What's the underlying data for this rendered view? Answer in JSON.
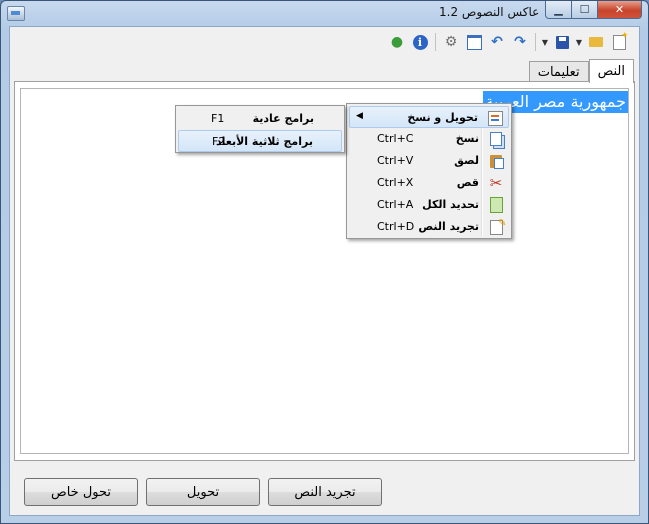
{
  "window": {
    "title": "عاكس النصوص 1.2"
  },
  "toolbar": {
    "items": [
      "new-file-icon",
      "open-folder-icon",
      "save-icon",
      "save-dropdown-icon",
      "redo-icon",
      "undo-icon",
      "window-icon",
      "settings-icon",
      "info-icon",
      "globe-icon"
    ]
  },
  "tabs": [
    {
      "label": "النص",
      "active": true
    },
    {
      "label": "تعليمات",
      "active": false
    }
  ],
  "editor": {
    "selected_text": "جمهورية مصر العربية"
  },
  "context_menu": {
    "items": [
      {
        "label": "تحويل و نسخ",
        "shortcut": "",
        "icon": "convert-copy-icon",
        "submenu": true,
        "highlighted": true
      },
      {
        "label": "نسخ",
        "shortcut": "Ctrl+C",
        "icon": "copy-icon"
      },
      {
        "label": "لصق",
        "shortcut": "Ctrl+V",
        "icon": "paste-icon"
      },
      {
        "label": "قص",
        "shortcut": "Ctrl+X",
        "icon": "cut-icon"
      },
      {
        "label": "تحديد الكل",
        "shortcut": "Ctrl+A",
        "icon": "select-all-icon"
      },
      {
        "label": "تجريد النص",
        "shortcut": "Ctrl+D",
        "icon": "strip-text-icon"
      }
    ]
  },
  "submenu": {
    "items": [
      {
        "label": "برامج عادية",
        "shortcut": "F1",
        "highlighted": false
      },
      {
        "label": "برامج ثلاثية الأبعاد",
        "shortcut": "F2",
        "highlighted": true
      }
    ]
  },
  "buttons": {
    "special": "تحول خاص",
    "convert": "تحويل",
    "strip": "تجريد النص"
  }
}
